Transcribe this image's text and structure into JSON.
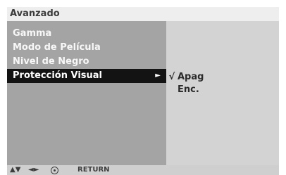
{
  "menu": {
    "title": "Avanzado",
    "items": [
      {
        "label": "Gamma",
        "selected": false
      },
      {
        "label": "Modo de Película",
        "selected": false
      },
      {
        "label": "Nivel de Negro",
        "selected": false
      },
      {
        "label": "Protección Visual",
        "selected": true,
        "arrow": "►"
      }
    ]
  },
  "options": {
    "items": [
      {
        "check": "√",
        "label": "Apag",
        "checked": true
      },
      {
        "check": "",
        "label": "Enc.",
        "checked": false
      }
    ]
  },
  "footer": {
    "nav_updown": "▲▼",
    "nav_leftright": "◄►",
    "ok_icon": "ok-circle-icon",
    "return_label": "RETURN"
  },
  "colors": {
    "title_bar": "#eeeeee",
    "menu_panel": "#a4a4a4",
    "options_panel": "#d3d3d3",
    "selected_row": "#131313",
    "footer": "#cfcfcf"
  }
}
